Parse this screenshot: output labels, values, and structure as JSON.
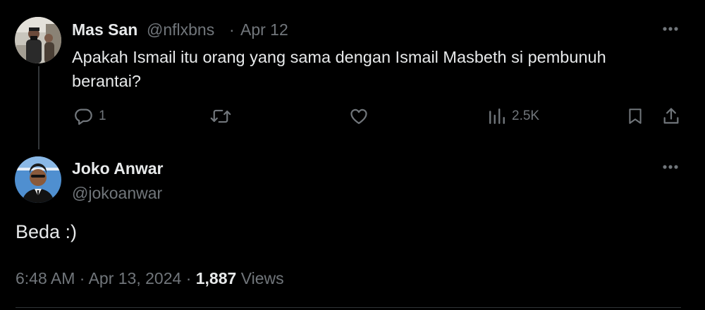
{
  "parent_tweet": {
    "author_name": "Mas San",
    "handle": "@nflxbns",
    "separator": "·",
    "date": "Apr 12",
    "text": "Apakah Ismail itu orang yang sama dengan Ismail Masbeth si pembunuh berantai?",
    "actions": {
      "reply_count": "1",
      "view_count": "2.5K"
    },
    "icons": [
      "reply-icon",
      "retweet-icon",
      "like-icon",
      "views-icon",
      "bookmark-icon",
      "share-icon",
      "more-icon"
    ]
  },
  "main_tweet": {
    "author_name": "Joko Anwar",
    "handle": "@jokoanwar",
    "text": "Beda :)",
    "time": "6:48 AM",
    "separator": "·",
    "date": "Apr 13, 2024",
    "views_separator": "·",
    "views_count": "1,887",
    "views_label": "Views",
    "icons": [
      "more-icon"
    ]
  },
  "colors": {
    "background": "#000000",
    "text_primary": "#e7e9ea",
    "text_secondary": "#71767b",
    "divider": "#2f3336"
  }
}
